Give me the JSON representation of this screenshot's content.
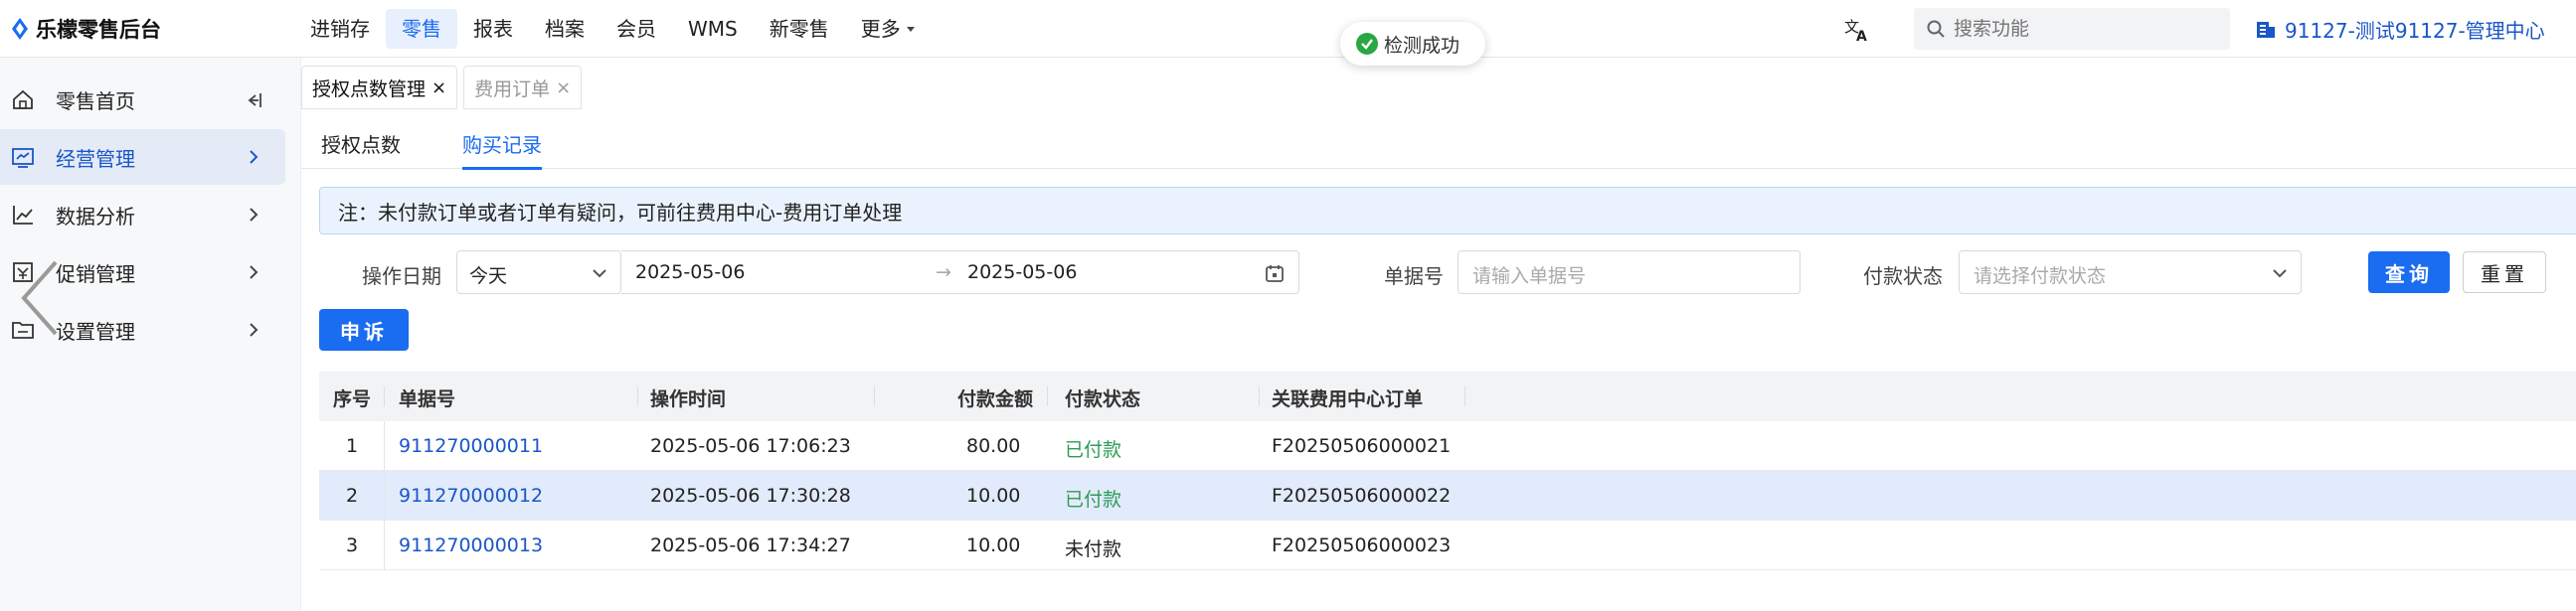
{
  "app": {
    "title": "乐檬零售后台"
  },
  "nav": {
    "items": [
      {
        "label": "进销存",
        "active": false
      },
      {
        "label": "零售",
        "active": true
      },
      {
        "label": "报表",
        "active": false
      },
      {
        "label": "档案",
        "active": false
      },
      {
        "label": "会员",
        "active": false
      },
      {
        "label": "WMS",
        "active": false
      },
      {
        "label": "新零售",
        "active": false
      },
      {
        "label": "更多",
        "active": false
      }
    ]
  },
  "toast": {
    "text": "检测成功"
  },
  "search": {
    "placeholder": "搜索功能"
  },
  "org": {
    "label": "91127-测试91127-管理中心"
  },
  "sidebar": {
    "items": [
      {
        "label": "零售首页"
      },
      {
        "label": "经营管理"
      },
      {
        "label": "数据分析"
      },
      {
        "label": "促销管理"
      },
      {
        "label": "设置管理"
      }
    ]
  },
  "tabs": [
    {
      "label": "授权点数管理",
      "close": "×"
    },
    {
      "label": "费用订单",
      "close": "×"
    }
  ],
  "subtabs": [
    {
      "label": "授权点数"
    },
    {
      "label": "购买记录"
    }
  ],
  "notice": {
    "text": "注：未付款订单或者订单有疑问，可前往费用中心-费用订单处理"
  },
  "filters": {
    "date_label": "操作日期",
    "date_preset": "今天",
    "date_start": "2025-05-06",
    "date_arrow": "→",
    "date_end": "2025-05-06",
    "doc_label": "单据号",
    "doc_placeholder": "请输入单据号",
    "pay_label": "付款状态",
    "pay_placeholder": "请选择付款状态",
    "query_label": "查询",
    "reset_label": "重置"
  },
  "appeal": {
    "label": "申诉"
  },
  "table": {
    "columns": [
      "序号",
      "单据号",
      "操作时间",
      "付款金额",
      "付款状态",
      "关联费用中心订单"
    ],
    "rows": [
      {
        "no": "1",
        "doc": "911270000011",
        "time": "2025-05-06 17:06:23",
        "amount": "80.00",
        "status": "已付款",
        "order": "F20250506000021"
      },
      {
        "no": "2",
        "doc": "911270000012",
        "time": "2025-05-06 17:30:28",
        "amount": "10.00",
        "status": "已付款",
        "order": "F20250506000022"
      },
      {
        "no": "3",
        "doc": "911270000013",
        "time": "2025-05-06 17:34:27",
        "amount": "10.00",
        "status": "未付款",
        "order": "F20250506000023"
      }
    ]
  },
  "colors": {
    "accent": "#1a6cf0",
    "paid": "#2e9b57",
    "link": "#1a56c8"
  }
}
